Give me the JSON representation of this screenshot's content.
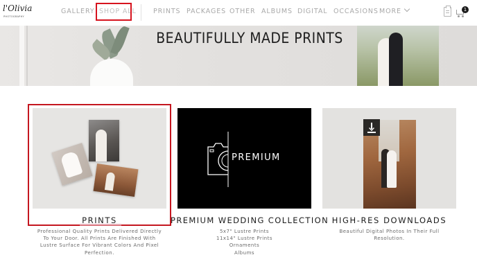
{
  "header": {
    "logo": {
      "script": "l'Olivia",
      "subtext": "PHOTOGRAPHY"
    },
    "nav_left": [
      "GALLERY",
      "SHOP ALL"
    ],
    "nav_right": [
      "PRINTS",
      "PACKAGES",
      "OTHER",
      "ALBUMS",
      "DIGITAL",
      "OCCASIONS"
    ],
    "more_label": "MORE",
    "cart_count": "1",
    "icons": [
      "clipboard-icon",
      "cart-icon",
      "chevron-down-icon"
    ]
  },
  "hero": {
    "title": "BEAUTIFULLY MADE PRINTS"
  },
  "cards": [
    {
      "title": "PRINTS",
      "description": [
        "Professional Quality Prints Delivered Directly",
        "To Your Door. All Prints Are Finished With",
        "Lustre Surface For Vibrant Colors And Pixel",
        "Perfection."
      ]
    },
    {
      "title": "PREMIUM WEDDING COLLECTION",
      "image_text": "PREMIUM",
      "description": [
        "5x7\" Lustre Prints",
        "11x14\" Lustre Prints",
        "Ornaments",
        "Albums"
      ]
    },
    {
      "title": "HIGH-RES DOWNLOADS",
      "description": [
        "Beautiful Digital Photos In Their Full",
        "Resolution."
      ]
    }
  ],
  "colors": {
    "highlight": "#d6131e",
    "nav_text": "#a9a9a9",
    "title_text": "#1b1b1b"
  }
}
